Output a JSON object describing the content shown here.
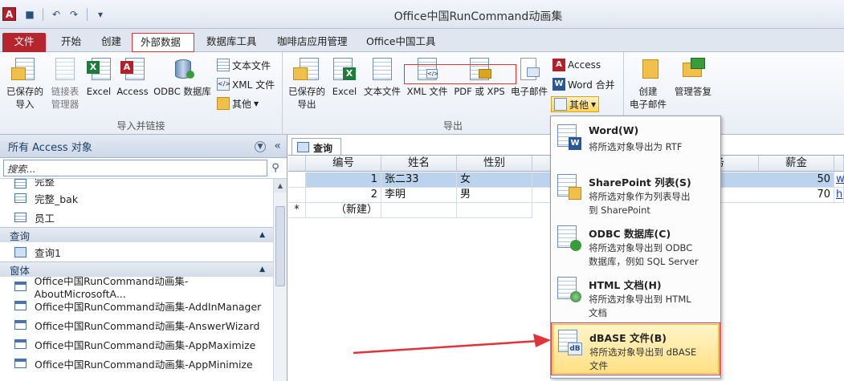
{
  "app": {
    "icon_letter": "A",
    "title": "Office中国RunCommand动画集"
  },
  "tabs": [
    "文件",
    "开始",
    "创建",
    "外部数据",
    "数据库工具",
    "咖啡店应用管理",
    "Office中国工具"
  ],
  "ribbon": {
    "import_group": {
      "label": "导入并链接",
      "buttons": [
        "已保存的\n导入",
        "链接表\n管理器",
        "Excel",
        "Access",
        "ODBC 数据库"
      ],
      "small": [
        "文本文件",
        "XML 文件",
        "其他"
      ]
    },
    "export_group": {
      "label": "导出",
      "buttons": [
        "已保存的\n导出",
        "Excel",
        "文本文件",
        "XML 文件",
        "PDF 或 XPS",
        "电子邮件"
      ],
      "small": [
        "Access",
        "Word 合并",
        "其他"
      ]
    },
    "collect_group": {
      "buttons": [
        "创建\n电子邮件",
        "管理答复"
      ]
    }
  },
  "nav": {
    "header": "所有 Access 对象",
    "search_placeholder": "搜索...",
    "tables": [
      "完整",
      "完整_bak",
      "员工"
    ],
    "sections": [
      {
        "label": "查询",
        "items": [
          "查询1"
        ]
      },
      {
        "label": "窗体",
        "items": [
          "Office中国RunCommand动画集-AboutMicrosoftA...",
          "Office中国RunCommand动画集-AddInManager",
          "Office中国RunCommand动画集-AnswerWizard",
          "Office中国RunCommand动画集-AppMaximize",
          "Office中国RunCommand动画集-AppMinimize"
        ]
      }
    ]
  },
  "document": {
    "tab_label": "查询1",
    "columns": [
      "编号",
      "姓名",
      "性别",
      "务",
      "薪金"
    ],
    "rows": [
      {
        "id": "1",
        "name": "张二33",
        "sex": "女",
        "salary": "50",
        "link": "w"
      },
      {
        "id": "2",
        "name": "李明",
        "sex": "男",
        "salary": "70",
        "link": "h"
      }
    ],
    "new_row_marker": "*",
    "new_row_label": "（新建）"
  },
  "menu": {
    "items": [
      {
        "title": "Word(W)",
        "desc": "将所选对象导出为 RTF"
      },
      {
        "title": "SharePoint 列表(S)",
        "desc": "将所选对象作为列表导出\n到 SharePoint"
      },
      {
        "title": "ODBC 数据库(C)",
        "desc": "将所选对象导出到 ODBC\n数据库，例如 SQL Server"
      },
      {
        "title": "HTML 文档(H)",
        "desc": "将所选对象导出到 HTML\n文档"
      },
      {
        "title": "dBASE 文件(B)",
        "desc": "将所选对象导出到 dBASE\n文件"
      }
    ]
  },
  "colors": {
    "accent_red": "#e0343a",
    "file_tab": "#b6242d",
    "highlight": "#ffe085"
  }
}
